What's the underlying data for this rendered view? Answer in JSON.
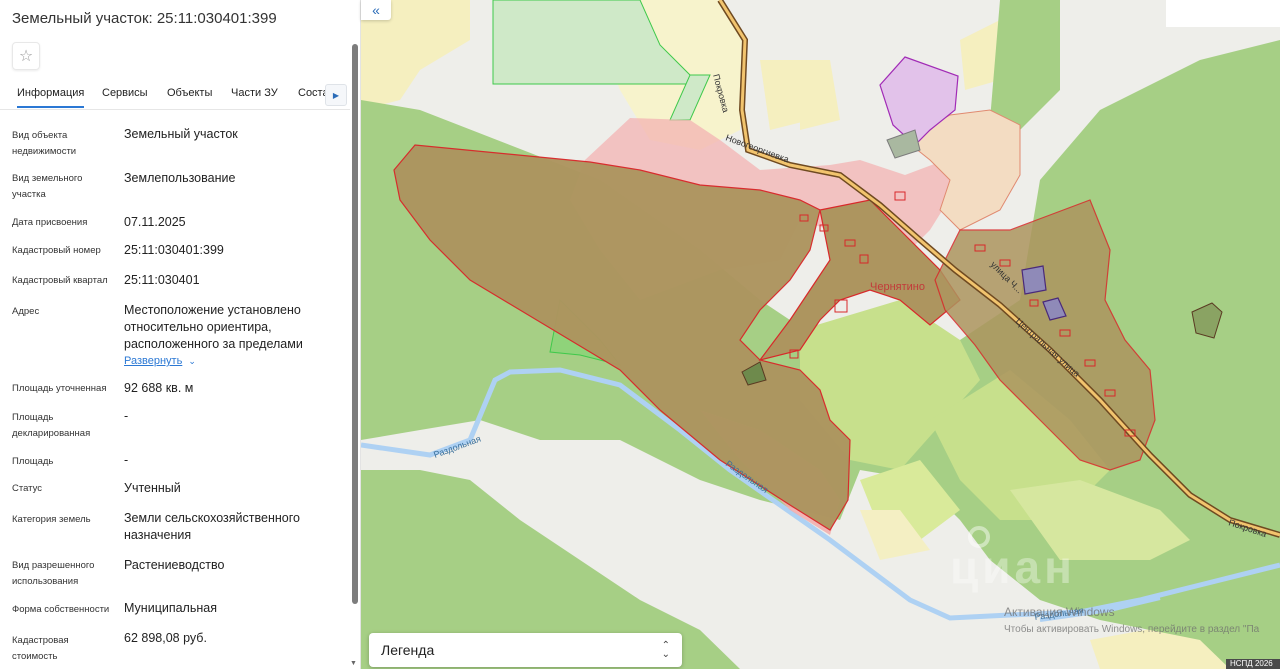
{
  "panel": {
    "title": "Земельный участок: 25:11:030401:399",
    "tabs": [
      {
        "label": "Информация",
        "active": true
      },
      {
        "label": "Сервисы"
      },
      {
        "label": "Объекты"
      },
      {
        "label": "Части ЗУ"
      },
      {
        "label": "Состав"
      }
    ],
    "rows": [
      {
        "label": "Вид объекта недвижимости",
        "value": "Земельный участок"
      },
      {
        "label": "Вид земельного участка",
        "value": "Землепользование"
      },
      {
        "label": "Дата присвоения",
        "value": "07.11.2025"
      },
      {
        "label": "Кадастровый номер",
        "value": "25:11:030401:399"
      },
      {
        "label": "Кадастровый квартал",
        "value": "25:11:030401"
      },
      {
        "label": "Адрес",
        "value": "Местоположение установлено относительно ориентира, расположенного за пределами"
      },
      {
        "label": "Площадь уточненная",
        "value": "92 688 кв. м"
      },
      {
        "label": "Площадь декларированная",
        "value": "-"
      },
      {
        "label": "Площадь",
        "value": "-"
      },
      {
        "label": "Статус",
        "value": "Учтенный"
      },
      {
        "label": "Категория земель",
        "value": "Земли сельскохозяйственного назначения"
      },
      {
        "label": "Вид разрешенного использования",
        "value": "Растениеводство"
      },
      {
        "label": "Форма собственности",
        "value": "Муниципальная"
      },
      {
        "label": "Кадастровая стоимость",
        "value": "62 898,08 руб."
      }
    ],
    "expand_label": "Развернуть"
  },
  "map": {
    "labels": {
      "village": "Чернятино",
      "road_pokrovka_top": "Покровка",
      "road_novogeorgievka": "Новогеоргиевка",
      "road_pokrovka_right": "Покровка",
      "river_1": "Раздольная",
      "river_2": "Раздольная",
      "river_3": "Раздольная",
      "street_central": "Центральная улица",
      "street_2": "улица Ч..."
    },
    "legend_label": "Легенда",
    "watermark_title": "Активация Windows",
    "watermark_text": "Чтобы активировать Windows, перейдите в раздел \"Па",
    "credit": "НСПД 2026",
    "brand": "циан"
  },
  "colors": {
    "accent": "#2b78d4",
    "parcel_fill": "#a88f5b",
    "parcel_stroke": "#d8282a",
    "forest": "#9fcc7a",
    "river": "#a9cdf0"
  }
}
